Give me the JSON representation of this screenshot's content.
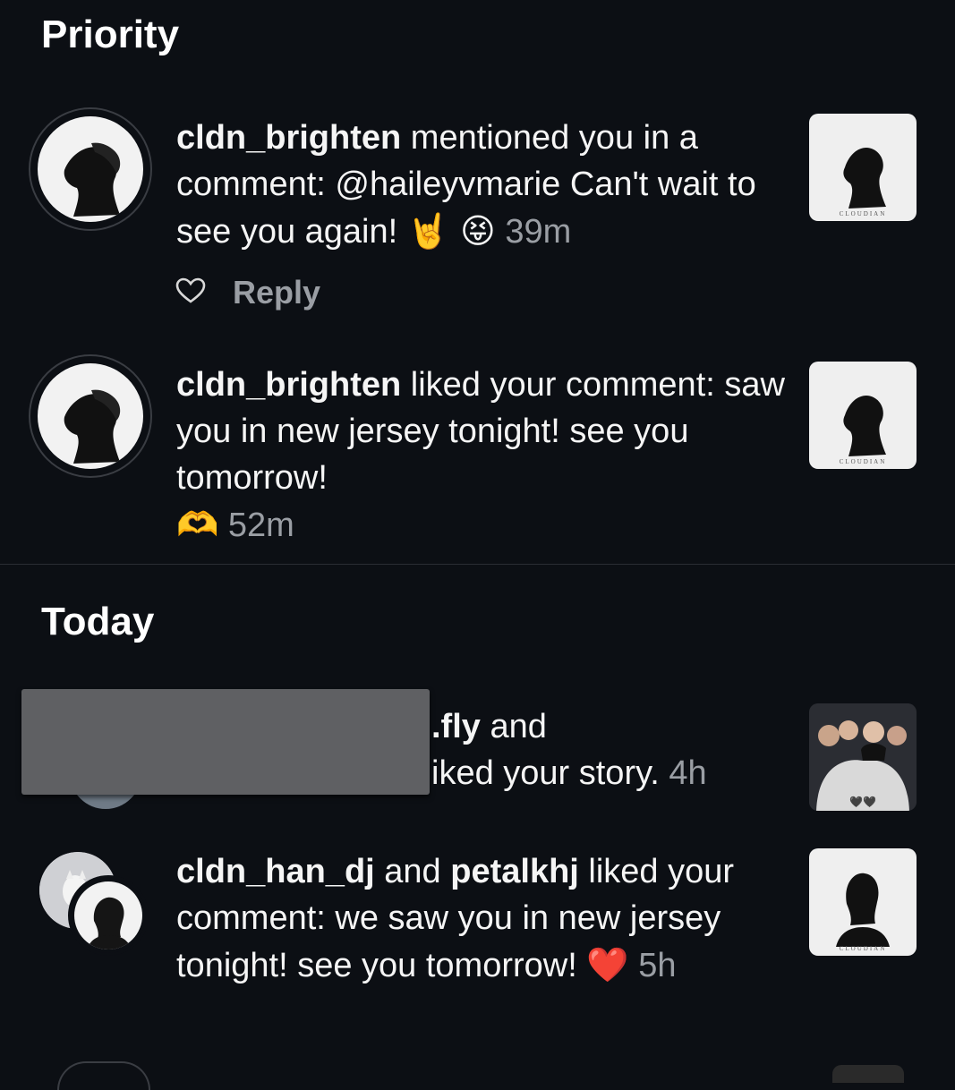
{
  "sections": {
    "priority": "Priority",
    "today": "Today"
  },
  "notifications": [
    {
      "username": "cldn_brighten",
      "text": " mentioned you in a comment: @haileyvmarie Can't wait to see you again! ",
      "emoji": "🤘 😝",
      "time": "39m",
      "reply_label": "Reply",
      "thumb_caption": "CLOUDIAN"
    },
    {
      "username": "cldn_brighten",
      "text": " liked your comment: saw you in new jersey tonight! see you tomorrow!",
      "reaction": "🫶",
      "time": "52m",
      "thumb_caption": "CLOUDIAN"
    },
    {
      "username_fragment": ".fly",
      "text_line1": " and",
      "text_line2": "iked your story. ",
      "time": "4h",
      "thumb_caption": "🖤🖤"
    },
    {
      "user1": "cldn_han_dj",
      "joiner": " and ",
      "user2": "petalkhj",
      "text": " liked your comment: we saw you in new jersey tonight! see you tomorrow! ",
      "emoji": "❤️",
      "time": "5h",
      "thumb_caption": "CLOUDIAN"
    }
  ],
  "icons": {
    "heart_outline": "heart-outline-icon"
  }
}
